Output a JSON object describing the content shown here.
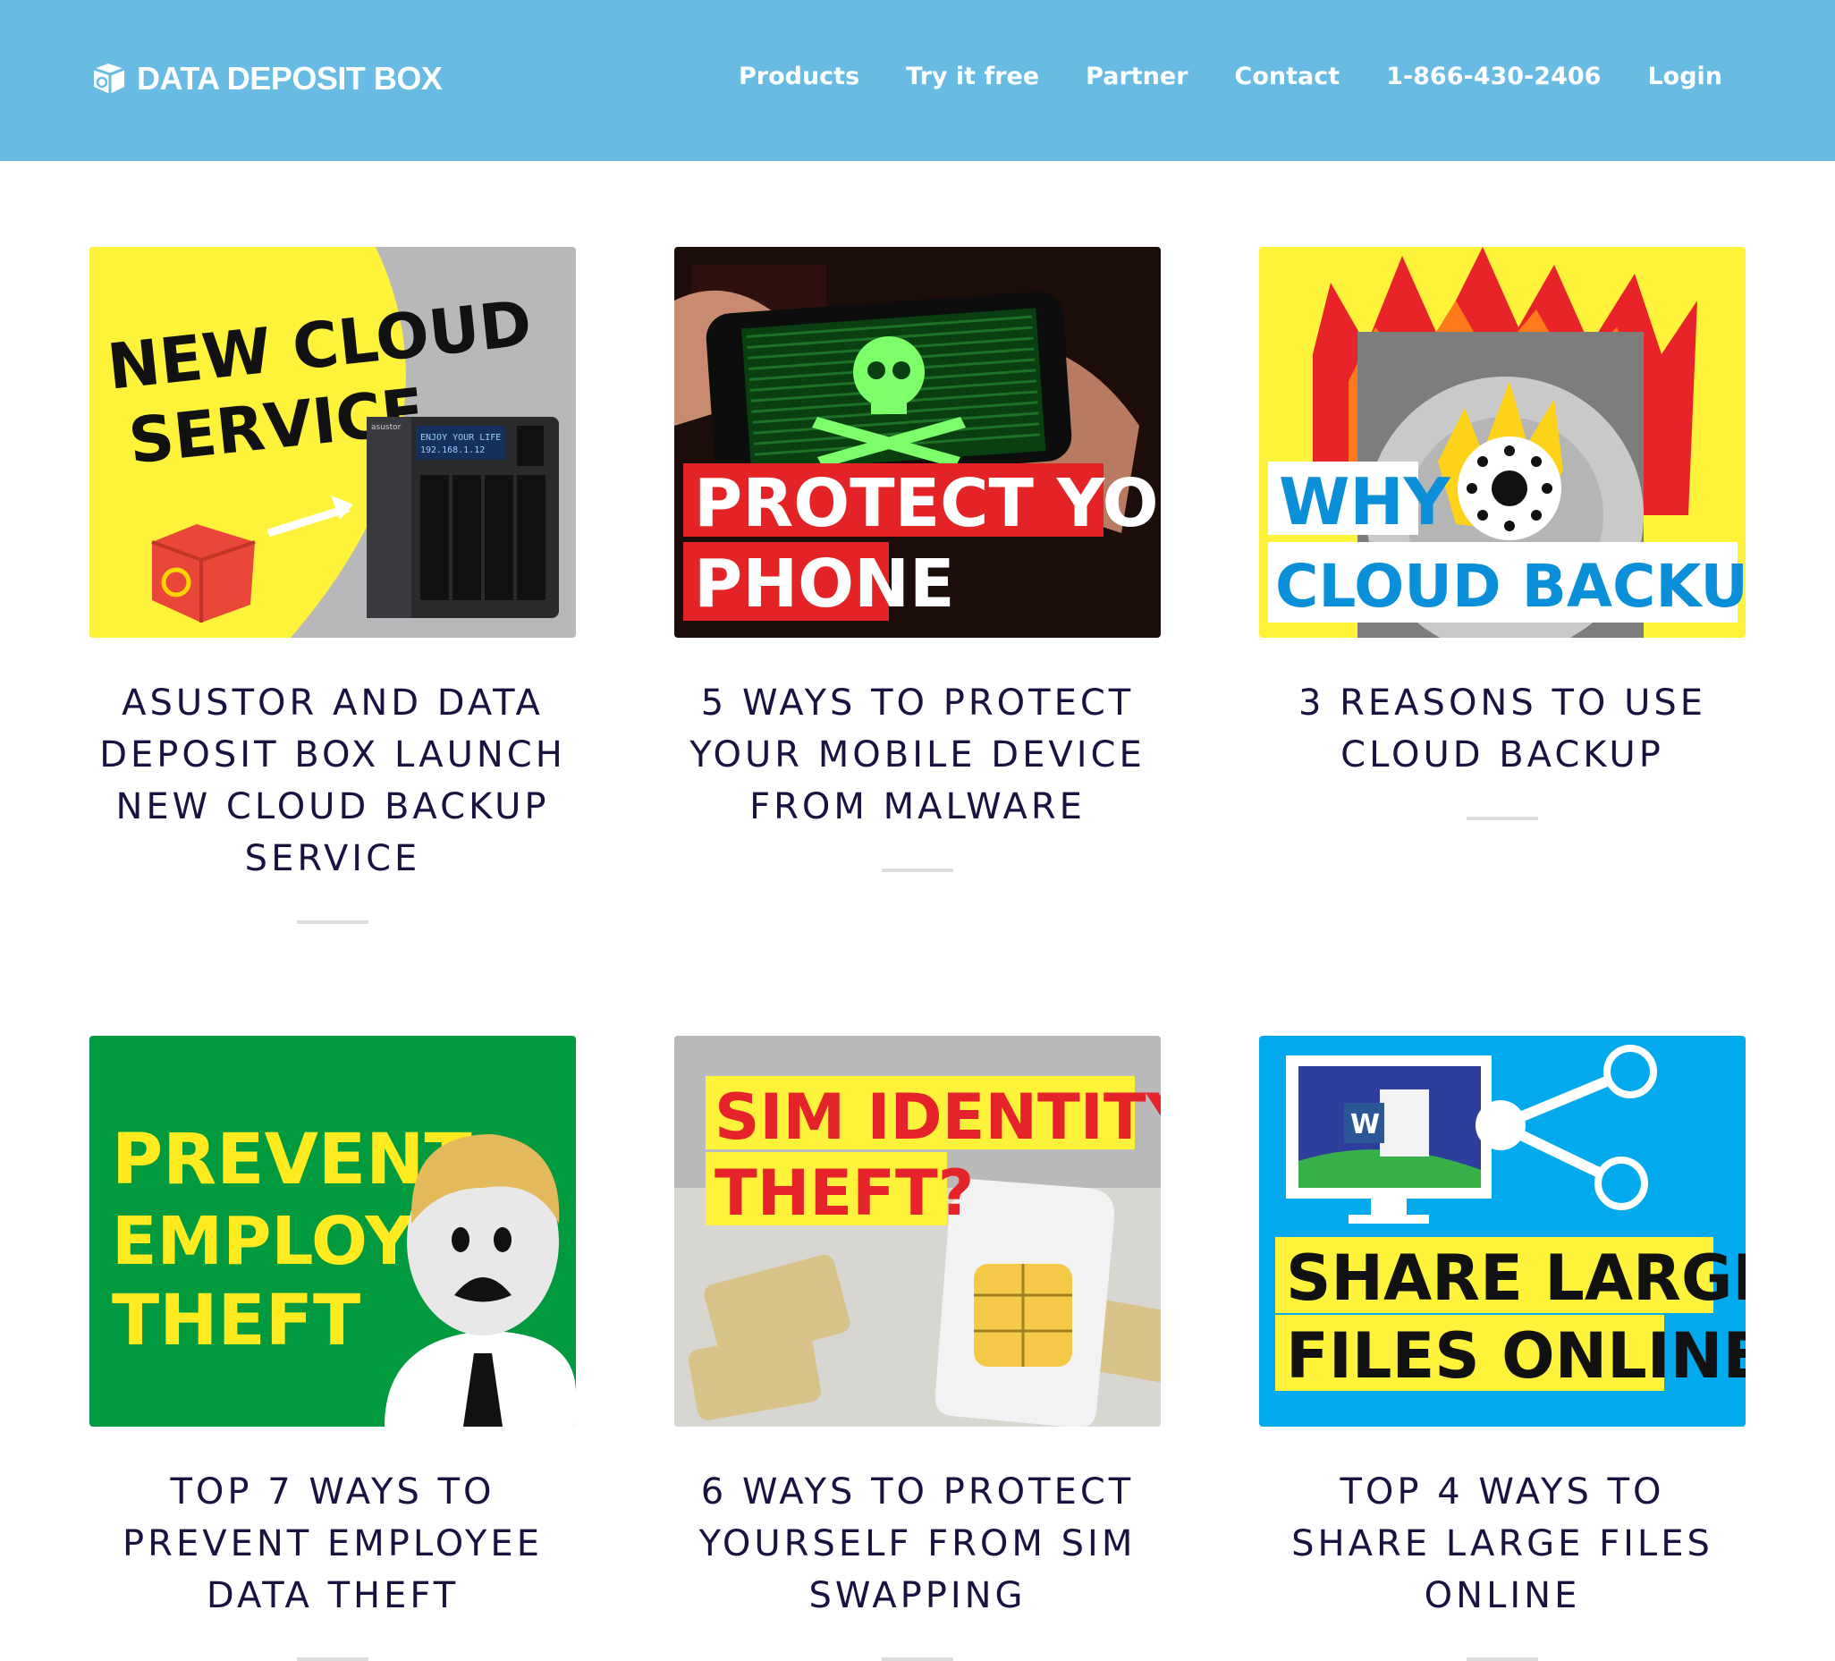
{
  "header": {
    "logo_text": "DATA DEPOSIT BOX",
    "nav": [
      "Products",
      "Try it free",
      "Partner",
      "Contact",
      "1-866-430-2406",
      "Login"
    ]
  },
  "colors": {
    "header_bg": "#68bbe3",
    "title_text": "#1a1240",
    "divider": "#dcdcdc"
  },
  "posts": [
    {
      "title": "ASUSTOR AND DATA DEPOSIT BOX LAUNCH NEW CLOUD BACKUP SERVICE",
      "image_text": [
        "NEW CLOUD",
        "SERVICE"
      ],
      "device_text": [
        "asustor",
        "ENJOY YOUR LIFE",
        "192.168.1.12"
      ]
    },
    {
      "title": "5 WAYS TO PROTECT YOUR MOBILE DEVICE FROM MALWARE",
      "image_text": [
        "PROTECT YOUR",
        "PHONE"
      ]
    },
    {
      "title": "3 REASONS TO USE CLOUD BACKUP",
      "image_text": [
        "WHY",
        "CLOUD BACKUP?"
      ]
    },
    {
      "title": "TOP 7 WAYS TO PREVENT EMPLOYEE DATA THEFT",
      "image_text": [
        "PREVENT",
        "EMPLOYEE",
        "THEFT"
      ]
    },
    {
      "title": "6 WAYS TO PROTECT YOURSELF FROM SIM SWAPPING",
      "image_text": [
        "SIM IDENTITY",
        "THEFT?"
      ]
    },
    {
      "title": "TOP 4 WAYS TO SHARE LARGE FILES ONLINE",
      "image_text": [
        "SHARE LARGE",
        "FILES ONLINE"
      ],
      "icon_letter": "W"
    }
  ]
}
